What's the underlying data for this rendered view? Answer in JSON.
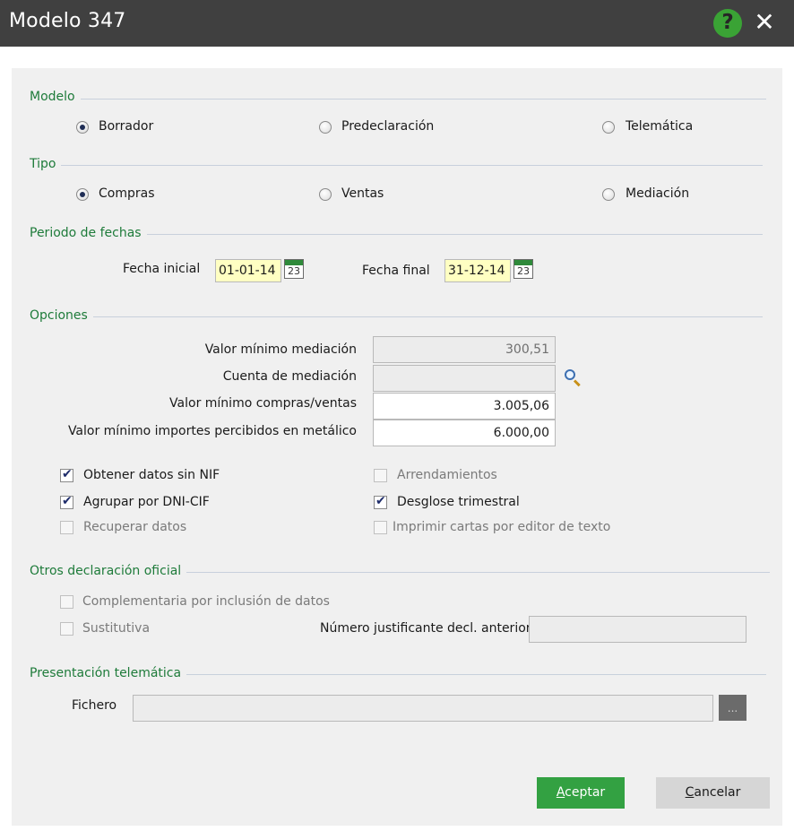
{
  "window": {
    "title": "Modelo 347",
    "help_icon": "help-icon",
    "help_glyph": "?",
    "close_glyph": "✕"
  },
  "modelo": {
    "title": "Modelo",
    "options": [
      {
        "label": "Borrador",
        "selected": true
      },
      {
        "label": "Predeclaración",
        "selected": false
      },
      {
        "label": "Telemática",
        "selected": false
      }
    ]
  },
  "tipo": {
    "title": "Tipo",
    "options": [
      {
        "label": "Compras",
        "selected": true
      },
      {
        "label": "Ventas",
        "selected": false
      },
      {
        "label": "Mediación",
        "selected": false
      }
    ]
  },
  "periodo": {
    "title": "Periodo de fechas",
    "fecha_inicial_label": "Fecha inicial",
    "fecha_inicial": "01-01-14",
    "fecha_final_label": "Fecha final",
    "fecha_final": "31-12-14",
    "calendar_day": "23"
  },
  "opciones": {
    "title": "Opciones",
    "valor_minimo_mediacion_label": "Valor mínimo mediación",
    "valor_minimo_mediacion": "300,51",
    "cuenta_mediacion_label": "Cuenta de mediación",
    "cuenta_mediacion": "",
    "valor_minimo_compras_label": "Valor mínimo compras/ventas",
    "valor_minimo_compras": "3.005,06",
    "valor_minimo_metalico_label": "Valor mínimo importes percibidos en metálico",
    "valor_minimo_metalico": "6.000,00",
    "checks": [
      {
        "label": "Obtener datos sin NIF",
        "checked": true,
        "enabled": true
      },
      {
        "label": "Arrendamientos",
        "checked": false,
        "enabled": false
      },
      {
        "label": "Agrupar por DNI-CIF",
        "checked": true,
        "enabled": true
      },
      {
        "label": "Desglose trimestral",
        "checked": true,
        "enabled": true
      },
      {
        "label": "Recuperar datos",
        "checked": false,
        "enabled": false
      },
      {
        "label": "Imprimir cartas por editor de texto",
        "checked": false,
        "enabled": false
      }
    ]
  },
  "otros": {
    "title": "Otros declaración oficial",
    "complementaria_label": "Complementaria por inclusión de datos",
    "sustitutiva_label": "Sustitutiva",
    "numero_justificante_label": "Número justificante decl. anterior",
    "numero_justificante": ""
  },
  "presentacion": {
    "title": "Presentación telemática",
    "fichero_label": "Fichero",
    "fichero": "",
    "browse_label": "..."
  },
  "buttons": {
    "aceptar_first": "A",
    "aceptar_rest": "ceptar",
    "cancelar_first": "C",
    "cancelar_rest": "ancelar"
  },
  "colors": {
    "accent": "#33a142",
    "section_title": "#1e7b3a",
    "titlebar": "#404040"
  }
}
